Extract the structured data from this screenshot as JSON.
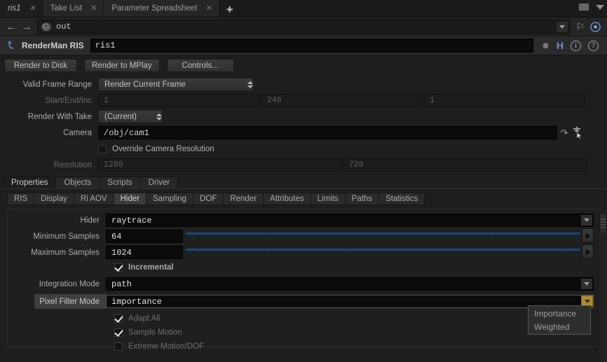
{
  "window_tabs": [
    {
      "label": "ris1",
      "active": true,
      "closable": true
    },
    {
      "label": "Take List",
      "active": false,
      "closable": true
    },
    {
      "label": "Parameter Spreadsheet",
      "active": false,
      "closable": true
    }
  ],
  "window_controls": {
    "add_tab": "+",
    "maximize": "maximize-box",
    "menu": "panel-menu"
  },
  "path_bar": {
    "back": "←",
    "forward": "→",
    "path": "out",
    "node_icon": "network-node-icon",
    "pin": "pin-icon",
    "target": "target-icon"
  },
  "node_header": {
    "type_label": "RenderMan RIS",
    "node_name": "ris1",
    "icons": [
      "gear-icon",
      "houdini-h-icon",
      "info-icon",
      "help-icon"
    ]
  },
  "buttons": {
    "render_to_disk": "Render to Disk",
    "render_to_mplay": "Render to MPlay",
    "controls": "Controls..."
  },
  "top_params": {
    "valid_frame_range": {
      "label": "Valid Frame Range",
      "value": "Render Current Frame"
    },
    "start_end_inc": {
      "label": "Start/End/Inc",
      "start": "1",
      "end": "240",
      "inc": "1"
    },
    "render_with_take": {
      "label": "Render With Take",
      "value": "(Current)"
    },
    "camera": {
      "label": "Camera",
      "value": "/obj/cam1"
    },
    "override_camera_resolution": {
      "label": "Override Camera Resolution",
      "checked": false
    },
    "resolution": {
      "label": "Resolution",
      "width": "1280",
      "height": "720"
    }
  },
  "primary_tabs": [
    {
      "label": "Properties",
      "active": true
    },
    {
      "label": "Objects",
      "active": false
    },
    {
      "label": "Scripts",
      "active": false
    },
    {
      "label": "Driver",
      "active": false
    }
  ],
  "secondary_tabs": [
    {
      "label": "RIS",
      "active": false
    },
    {
      "label": "Display",
      "active": false
    },
    {
      "label": "Ri AOV",
      "active": false
    },
    {
      "label": "Hider",
      "active": true
    },
    {
      "label": "Sampling",
      "active": false
    },
    {
      "label": "DOF",
      "active": false
    },
    {
      "label": "Render",
      "active": false
    },
    {
      "label": "Attributes",
      "active": false
    },
    {
      "label": "Limits",
      "active": false
    },
    {
      "label": "Paths",
      "active": false
    },
    {
      "label": "Statistics",
      "active": false
    }
  ],
  "hider": {
    "hider": {
      "label": "Hider",
      "value": "raytrace"
    },
    "minimum_samples": {
      "label": "Minimum Samples",
      "value": "64"
    },
    "maximum_samples": {
      "label": "Maximum Samples",
      "value": "1024"
    },
    "incremental": {
      "label": "Incremental",
      "checked": true
    },
    "integration_mode": {
      "label": "Integration Mode",
      "value": "path"
    },
    "pixel_filter_mode": {
      "label": "Pixel Filter Mode",
      "value": "importance"
    },
    "adapt_all": {
      "label": "Adapt All",
      "checked": true
    },
    "sample_motion": {
      "label": "Sample Motion",
      "checked": true
    },
    "extreme_motion_dof": {
      "label": "Extreme Motion/DOF",
      "checked": false
    }
  },
  "dropdown_menu": {
    "open": true,
    "items": [
      {
        "label": "Importance"
      },
      {
        "label": "Weighted"
      }
    ]
  },
  "colors": {
    "accent_gold": "#b08a2e",
    "slider_blue": "#1b4a78",
    "bg": "#1e1e1e",
    "field_bg": "#0b0b0b"
  }
}
